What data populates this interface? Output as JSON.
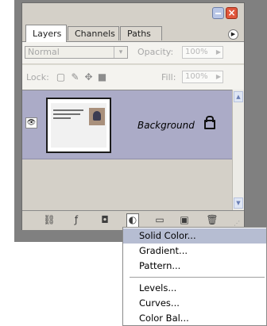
{
  "panel": {
    "tabs": [
      {
        "label": "Layers",
        "active": true
      },
      {
        "label": "Channels",
        "active": false
      },
      {
        "label": "Paths",
        "active": false
      }
    ],
    "close_glyph": "×",
    "menu_glyph": "▶"
  },
  "blend_mode": {
    "value": "Normal",
    "drop_glyph": "▾"
  },
  "opacity": {
    "label": "Opacity:",
    "value": "100%",
    "arrow": "▶"
  },
  "lock": {
    "label": "Lock:"
  },
  "fill": {
    "label": "Fill:",
    "value": "100%",
    "arrow": "▶"
  },
  "layers": [
    {
      "name": "Background",
      "visible": true,
      "locked": true,
      "eye_glyph": "👁"
    }
  ],
  "scrollbar": {
    "up_glyph": "▲",
    "down_glyph": "▼"
  },
  "bottom_icons": [
    {
      "name": "link-layers-icon",
      "glyph": "⛓"
    },
    {
      "name": "layer-style-icon",
      "glyph": "ƒ"
    },
    {
      "name": "add-mask-icon",
      "glyph": "◘"
    },
    {
      "name": "adjustment-layer-icon",
      "glyph": "◐"
    },
    {
      "name": "new-group-icon",
      "glyph": "▭"
    },
    {
      "name": "new-layer-icon",
      "glyph": "▣"
    },
    {
      "name": "trash-icon",
      "glyph": "🗑"
    }
  ],
  "dropdown_menu": {
    "items": [
      "Solid Color...",
      "Gradient...",
      "Pattern...",
      "Levels...",
      "Curves...",
      "Color Bal..."
    ],
    "highlighted_index": 0
  },
  "colors": {
    "panel_bg": "#d4d0c8",
    "selected_layer": "#ababc7",
    "menu_highlight": "#b6bdd2",
    "close_button": "#e0573c"
  }
}
